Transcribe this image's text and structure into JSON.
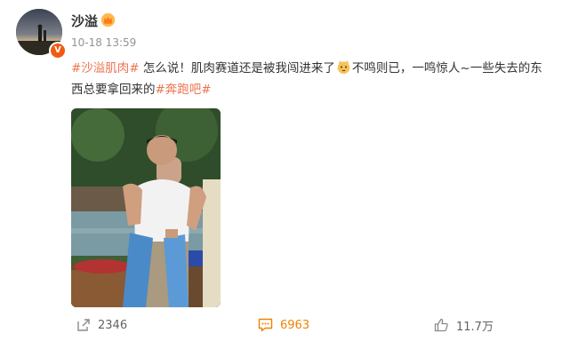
{
  "post": {
    "user_name": "沙溢",
    "time": "10-18 13:59",
    "text": {
      "hashtag_1": "#沙溢肌肉#",
      "part_1": " 怎么说！肌肉赛道还是被我闯进来了",
      "part_2": "不鸣则已，一鸣惊人~一些失去的东西总要拿回来的",
      "hashtag_2": "#奔跑吧#"
    },
    "verify_badge": "V"
  },
  "actions": {
    "share_count": "2346",
    "comment_count": "6963",
    "like_count": "11.7万"
  },
  "icons": {
    "crown": "crown-icon",
    "emoji": "cat-emoji-icon",
    "share": "share-icon",
    "comment": "comment-icon",
    "like": "thumbs-up-icon"
  },
  "colors": {
    "hashtag": "#eb7350",
    "comment_accent": "#f08300",
    "meta_gray": "#939393"
  }
}
